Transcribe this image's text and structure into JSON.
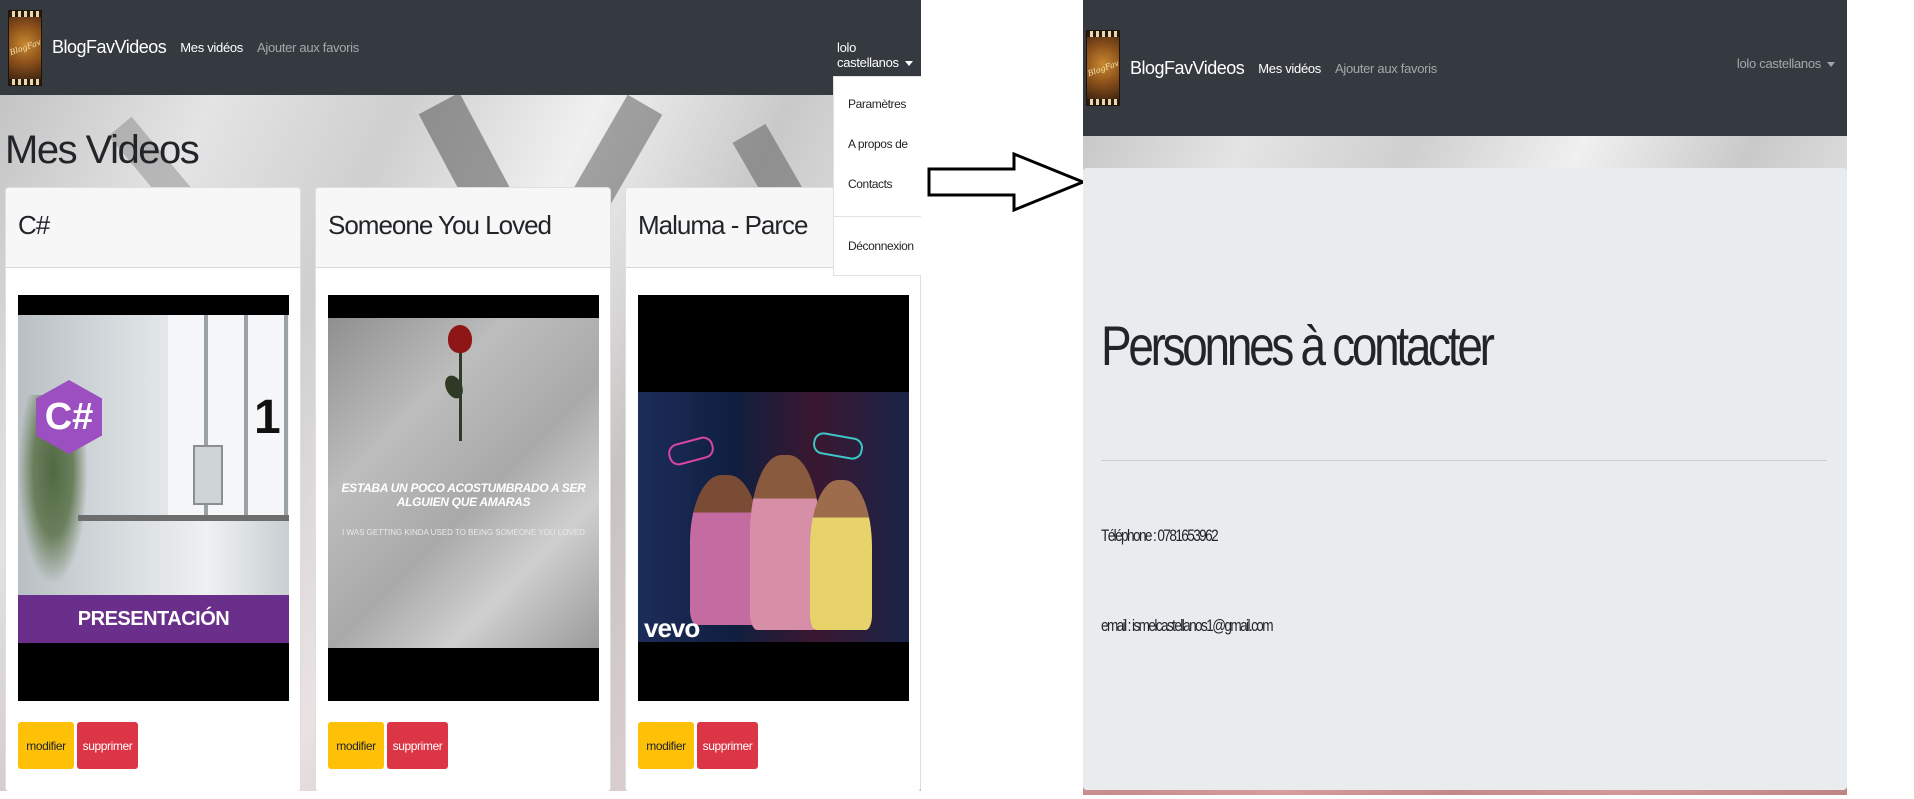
{
  "left_screen": {
    "navbar": {
      "logo_text": "BlogFav",
      "brand": "BlogFavVideos",
      "links": [
        "Mes vidéos",
        "Ajouter aux favoris"
      ],
      "user_name": "lolo castellanos"
    },
    "dropdown": {
      "items": [
        "Paramètres",
        "A propos de",
        "Contacts",
        "Déconnexion"
      ]
    },
    "page_title": "Mes Videos",
    "cards": [
      {
        "title": "C#",
        "thumb_text": "PRESENTACIÓN",
        "thumb_icon": "C#",
        "thumb_number": "1",
        "edit_label": "modifier",
        "delete_label": "supprimer"
      },
      {
        "title": "Someone You Loved",
        "thumb_text": "ESTABA UN POCO ACOSTUMBRADO A SER ALGUIEN QUE AMARAS",
        "thumb_subtext": "I WAS GETTING KINDA USED TO BEING SOMEONE YOU LOVED",
        "edit_label": "modifier",
        "delete_label": "supprimer"
      },
      {
        "title": "Maluma - Parce",
        "thumb_text": "vevo",
        "edit_label": "modifier",
        "delete_label": "supprimer"
      }
    ]
  },
  "right_screen": {
    "navbar": {
      "logo_text": "BlogFav",
      "brand": "BlogFavVideos",
      "links": [
        "Mes vidéos",
        "Ajouter aux favoris"
      ],
      "user_name": "lolo castellanos"
    },
    "jumbotron": {
      "title": "Personnes à contacter",
      "phone_label": "Téléphone :",
      "phone_value": "0781653962",
      "email_label": "email :",
      "email_value": "ismelcastellanos1@gmail.com"
    }
  },
  "arrow_icon": "right-arrow-icon",
  "colors": {
    "navbar": "#343a40",
    "warning": "#ffc107",
    "danger": "#dc3545",
    "jumbotron": "#e9ecef"
  }
}
